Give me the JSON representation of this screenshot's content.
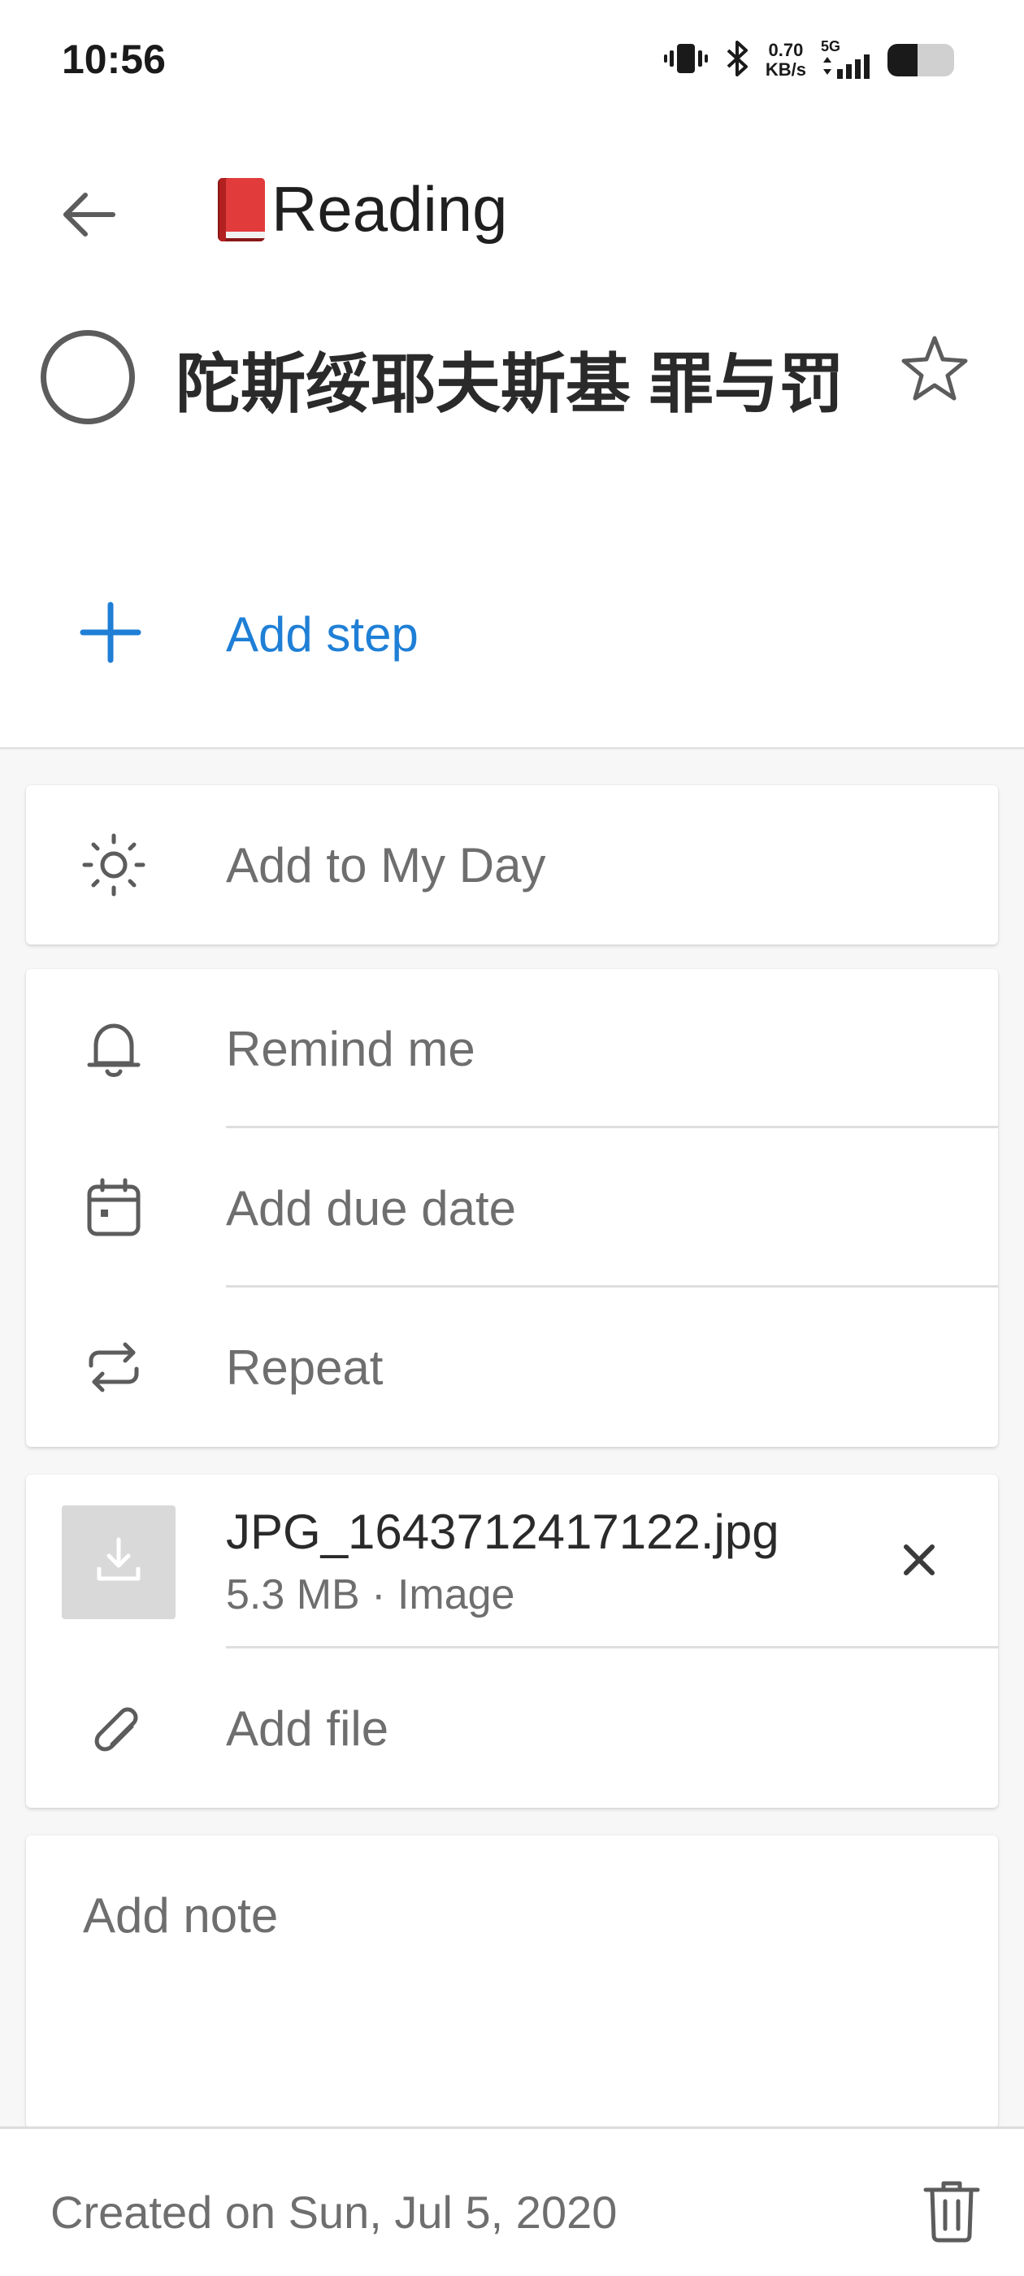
{
  "status_bar": {
    "time": "10:56",
    "net_speed_value": "0.70",
    "net_speed_unit": "KB/s",
    "net_type": "5G",
    "battery_level": 0.45
  },
  "header": {
    "list_title": "Reading"
  },
  "task": {
    "title": "陀斯绥耶夫斯基 罪与罚",
    "add_step_label": "Add step"
  },
  "my_day": {
    "label": "Add to My Day"
  },
  "scheduling": {
    "remind_label": "Remind me",
    "due_label": "Add due date",
    "repeat_label": "Repeat"
  },
  "files": {
    "attachment": {
      "name": "JPG_1643712417122.jpg",
      "meta": "5.3 MB · Image"
    },
    "add_file_label": "Add file"
  },
  "note": {
    "placeholder": "Add note"
  },
  "footer": {
    "created_text": "Created on Sun, Jul 5, 2020"
  },
  "colors": {
    "accent": "#1f7fd6",
    "icon_gray": "#5c5c5c",
    "secondary_text": "#6e6e6e",
    "book_red": "#d93030"
  }
}
